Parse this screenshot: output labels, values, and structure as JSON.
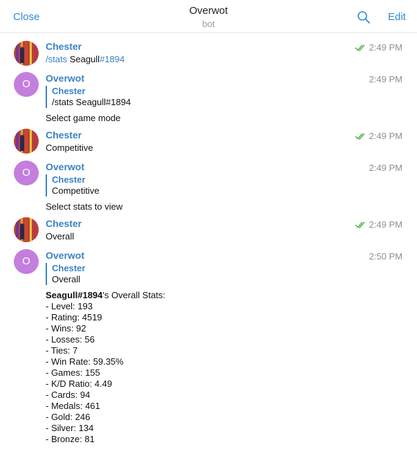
{
  "header": {
    "close_label": "Close",
    "title": "Overwot",
    "subtitle": "bot",
    "edit_label": "Edit"
  },
  "messages": [
    {
      "sender": "Chester",
      "time": "2:49 PM",
      "read": true,
      "command": "/stats",
      "command_rest_prefix": " Seagull",
      "command_link_tail": "#1894"
    },
    {
      "sender": "Overwot",
      "avatar_letter": "O",
      "time": "2:49 PM",
      "reply_name": "Chester",
      "reply_text": "/stats Seagull#1894",
      "text": "Select game mode"
    },
    {
      "sender": "Chester",
      "time": "2:49 PM",
      "read": true,
      "text": "Competitive"
    },
    {
      "sender": "Overwot",
      "avatar_letter": "O",
      "time": "2:49 PM",
      "reply_name": "Chester",
      "reply_text": "Competitive",
      "text": "Select stats to view"
    },
    {
      "sender": "Chester",
      "time": "2:49 PM",
      "read": true,
      "text": "Overall"
    },
    {
      "sender": "Overwot",
      "avatar_letter": "O",
      "time": "2:50 PM",
      "reply_name": "Chester",
      "reply_text": "Overall"
    }
  ],
  "stats": {
    "player": "Seagull#1894",
    "heading_suffix": "'s Overall Stats:",
    "lines": [
      "- Level: 193",
      "- Rating: 4519",
      "- Wins: 92",
      "- Losses: 56",
      "- Ties: 7",
      "- Win Rate: 59.35%",
      "- Games: 155",
      "- K/D Ratio: 4.49",
      "- Cards: 94",
      "- Medals: 461",
      "- Gold: 246",
      "- Silver: 134",
      "- Bronze: 81"
    ]
  },
  "colors": {
    "accent": "#2f8ad6",
    "sender": "#3a82c4",
    "bot_avatar": "#c47ede",
    "read_check": "#4cb24a",
    "time": "#8f8f8f"
  },
  "icons": {
    "search": "search-icon",
    "read": "double-check-icon",
    "user_avatar": "user-avatar-image"
  }
}
